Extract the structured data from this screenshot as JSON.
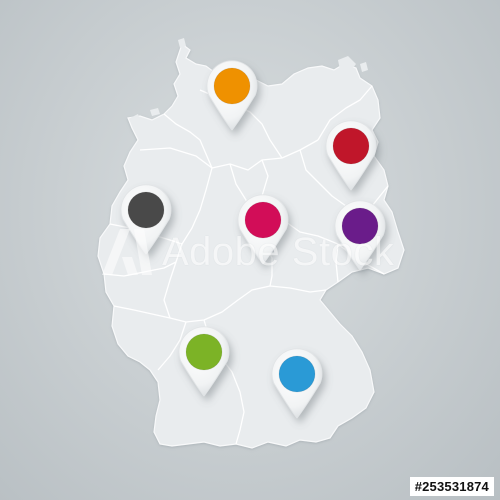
{
  "map": {
    "country": "Germany",
    "land_color": "#e9ecee",
    "border_color": "#ffffff"
  },
  "pins": [
    {
      "id": "north",
      "color": "#ef9100",
      "icon": "map-pin-icon"
    },
    {
      "id": "northeast",
      "color": "#c0162a",
      "icon": "map-pin-icon"
    },
    {
      "id": "west",
      "color": "#4a4a4a",
      "icon": "map-pin-icon"
    },
    {
      "id": "center",
      "color": "#d21158",
      "icon": "map-pin-icon"
    },
    {
      "id": "east",
      "color": "#6b1f8a",
      "icon": "map-pin-icon"
    },
    {
      "id": "southwest",
      "color": "#7cb327",
      "icon": "map-pin-icon"
    },
    {
      "id": "southeast",
      "color": "#2a9ad6",
      "icon": "map-pin-icon"
    }
  ],
  "watermark": {
    "text": "Adobe Stock"
  },
  "stock_id": "#253531874"
}
